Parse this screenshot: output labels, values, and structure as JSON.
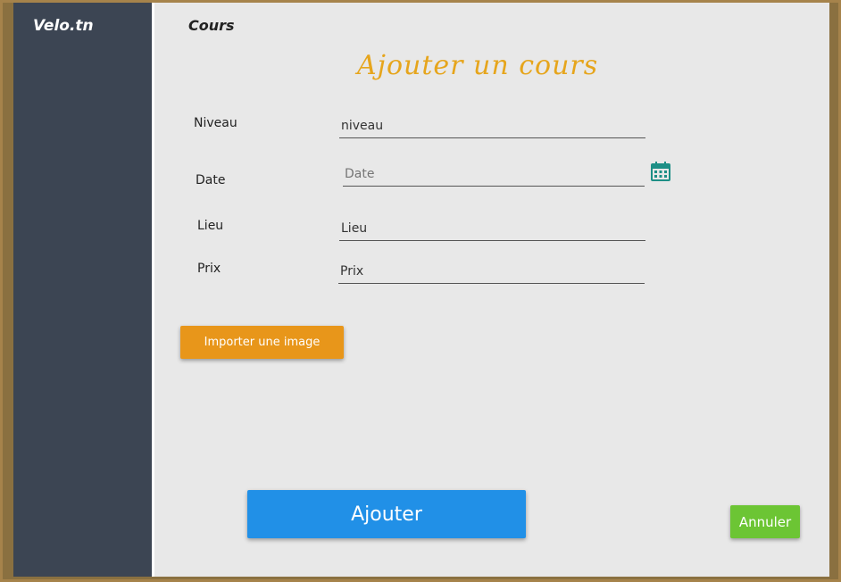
{
  "app": {
    "brand": "Velo.tn"
  },
  "header": {
    "section_title": "Cours"
  },
  "form": {
    "title": "Ajouter un cours",
    "fields": {
      "niveau": {
        "label": "Niveau",
        "value": "niveau"
      },
      "date": {
        "label": "Date",
        "placeholder": "Date"
      },
      "lieu": {
        "label": "Lieu",
        "value": "Lieu"
      },
      "prix": {
        "label": "Prix",
        "value": "Prix"
      }
    },
    "import_button": "Importer une image",
    "submit_button": "Ajouter",
    "cancel_button": "Annuler"
  },
  "colors": {
    "sidebar": "#3c4553",
    "title_accent": "#e6a51c",
    "import_button": "#e8961a",
    "submit_button": "#2190e7",
    "cancel_button": "#6cc534",
    "calendar_icon": "#1e8f86"
  },
  "icons": {
    "date_picker": "calendar-icon"
  }
}
